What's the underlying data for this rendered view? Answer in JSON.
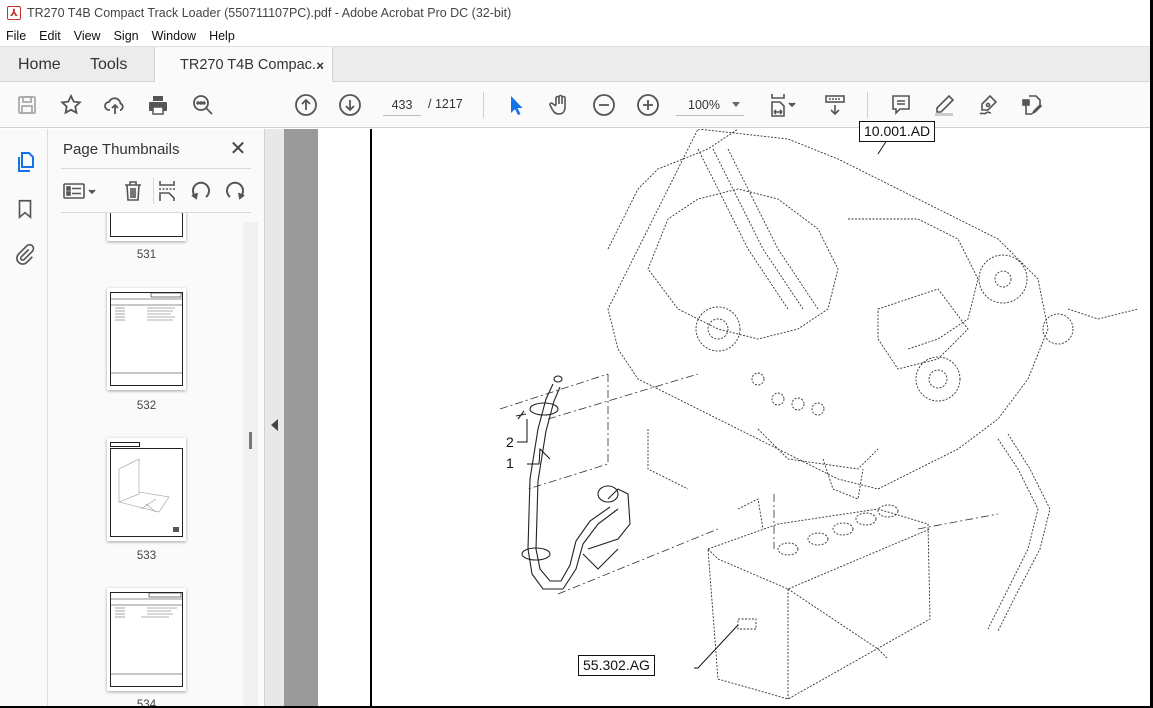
{
  "window": {
    "title": "TR270 T4B Compact Track Loader (550711107PC).pdf - Adobe Acrobat Pro DC (32-bit)",
    "app_icon": "acrobat-pdf-icon"
  },
  "menu": [
    "File",
    "Edit",
    "View",
    "Sign",
    "Window",
    "Help"
  ],
  "tabs": {
    "home": "Home",
    "tools": "Tools",
    "document": "TR270 T4B Compac...",
    "close_glyph": "×"
  },
  "toolbar": {
    "left_icons": [
      "save-icon",
      "bookmark-star-icon",
      "upload-cloud-icon",
      "print-icon",
      "find-icon"
    ],
    "prev_page": "previous-page-icon",
    "next_page": "next-page-icon",
    "current_page": "433",
    "total_pages": "/ 1217",
    "zoom_level": "100%",
    "right_icons": [
      "select-arrow-icon",
      "hand-tool-icon",
      "zoom-out-icon",
      "zoom-in-icon",
      "fit-page-icon",
      "scroll-mode-icon",
      "comment-icon",
      "highlight-icon",
      "sign-icon",
      "edit-pdf-icon"
    ],
    "accent_color": "#1473e6"
  },
  "left_rail": [
    "page-thumbnails-icon",
    "bookmarks-icon",
    "attachments-icon"
  ],
  "thumbnails_panel": {
    "title": "Page Thumbnails",
    "close_glyph": "✕",
    "tools": [
      "options-menu-icon",
      "delete-pages-icon",
      "insert-page-icon",
      "rotate-ccw-icon",
      "rotate-cw-icon"
    ],
    "pages": [
      {
        "label": "531"
      },
      {
        "label": "532"
      },
      {
        "label": "533"
      },
      {
        "label": "534"
      }
    ]
  },
  "document": {
    "callouts": [
      "10.001.AD",
      "55.302.AG"
    ],
    "part_numbers": [
      "1",
      "2"
    ]
  }
}
